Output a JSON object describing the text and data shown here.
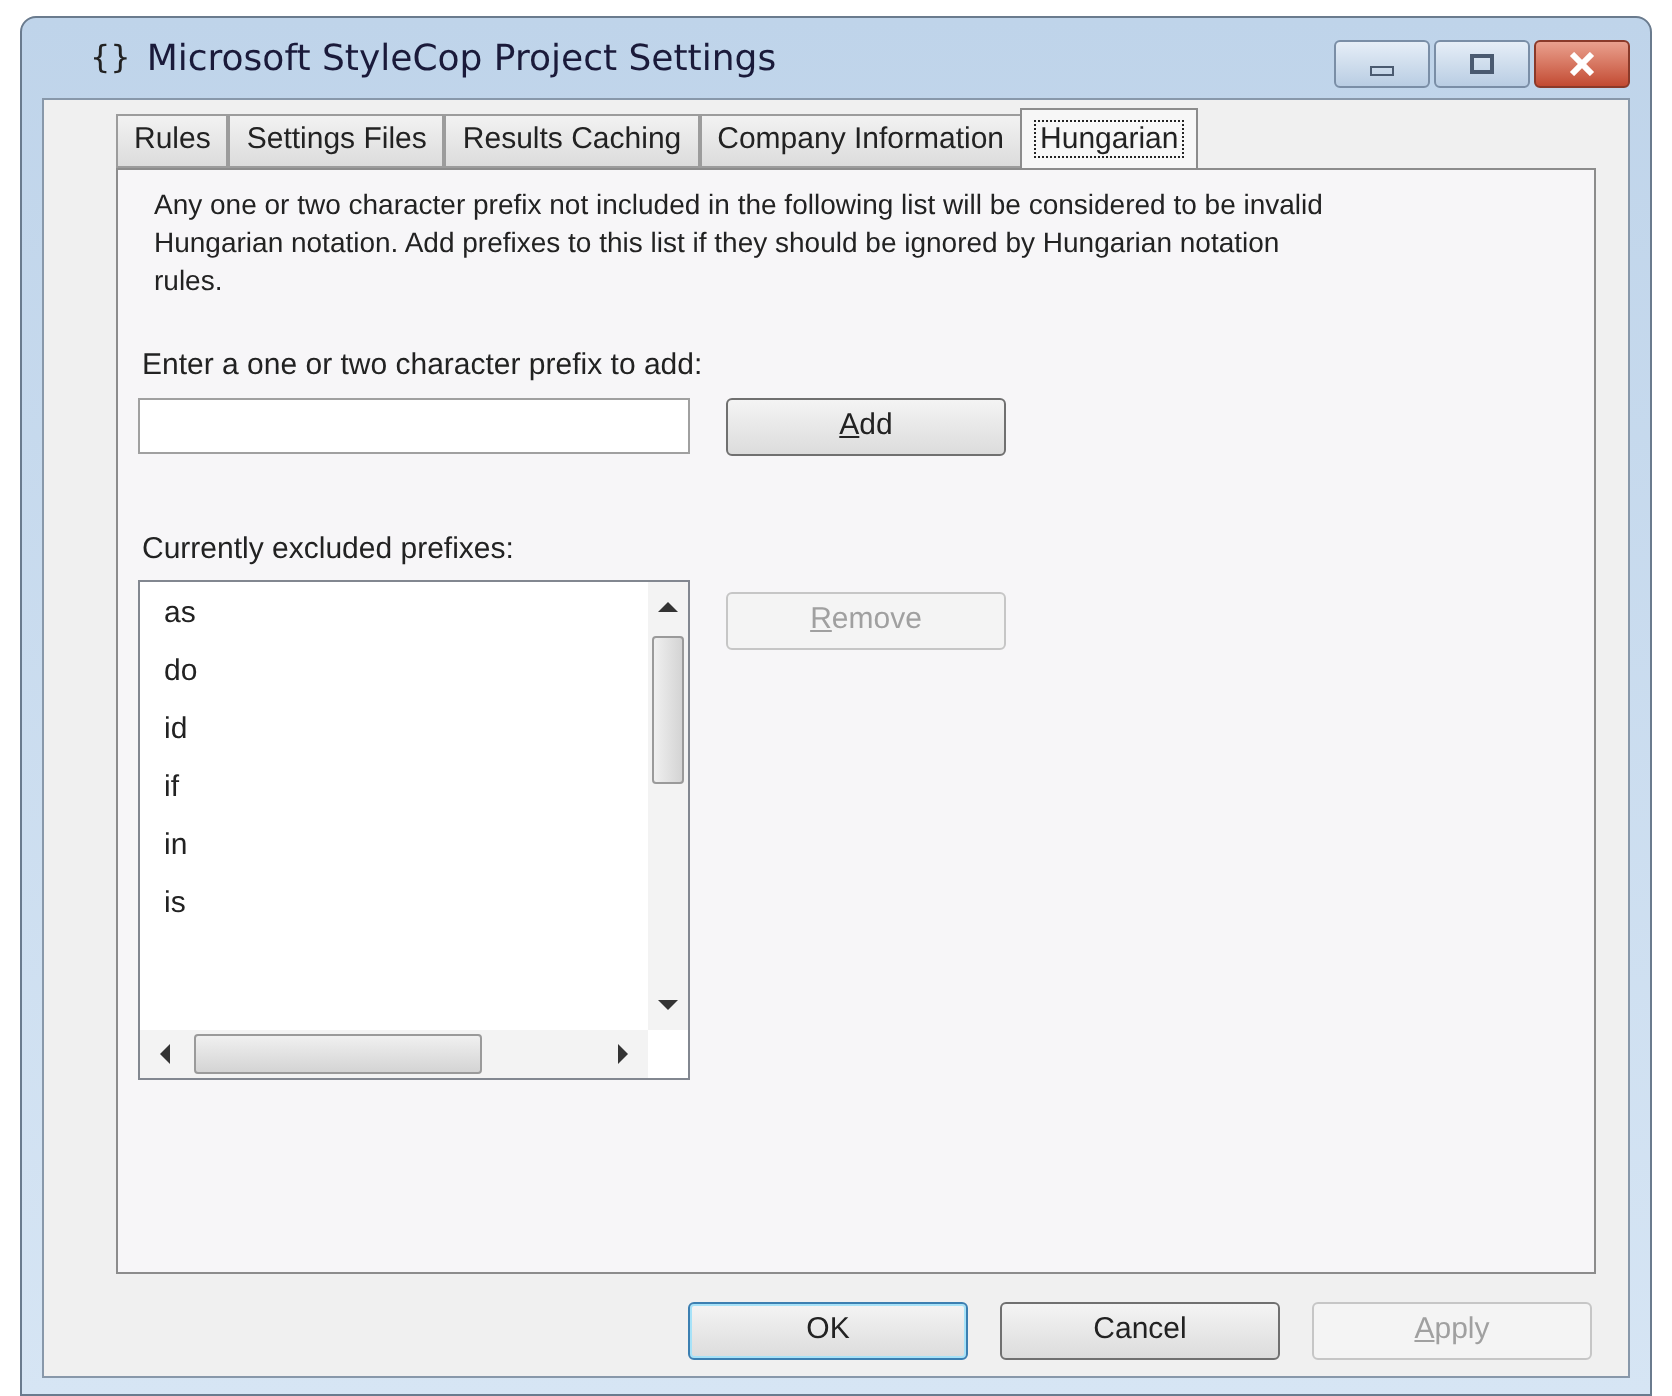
{
  "window": {
    "title": "Microsoft StyleCop Project Settings",
    "icon_text": "{}"
  },
  "tabs": [
    {
      "label": "Rules",
      "selected": false
    },
    {
      "label": "Settings Files",
      "selected": false
    },
    {
      "label": "Results Caching",
      "selected": false
    },
    {
      "label": "Company Information",
      "selected": false
    },
    {
      "label": "Hungarian",
      "selected": true
    }
  ],
  "description": "Any one or two character prefix not included in the following list will be considered to be invalid Hungarian notation. Add prefixes to this list if they should be ignored by Hungarian notation rules.",
  "prefix_field": {
    "label": "Enter a one or two character prefix to add:"
  },
  "add_button": {
    "mnemonic": "A",
    "rest": "dd",
    "disabled": false
  },
  "list": {
    "label": "Currently excluded prefixes:",
    "items": [
      {
        "text": "as",
        "selected": false
      },
      {
        "text": "do",
        "selected": false
      },
      {
        "text": "id",
        "selected": false
      },
      {
        "text": "if",
        "selected": false
      },
      {
        "text": "in",
        "selected": false
      },
      {
        "text": "is",
        "selected": false
      }
    ]
  },
  "remove_button": {
    "mnemonic": "R",
    "rest": "emove",
    "disabled": true
  },
  "buttons": [
    {
      "rest": "OK",
      "disabled": false,
      "default": true
    },
    {
      "rest": "Cancel",
      "disabled": false,
      "default": false
    },
    {
      "mnemonic": "A",
      "rest": "pply",
      "disabled": true,
      "default": false
    }
  ]
}
